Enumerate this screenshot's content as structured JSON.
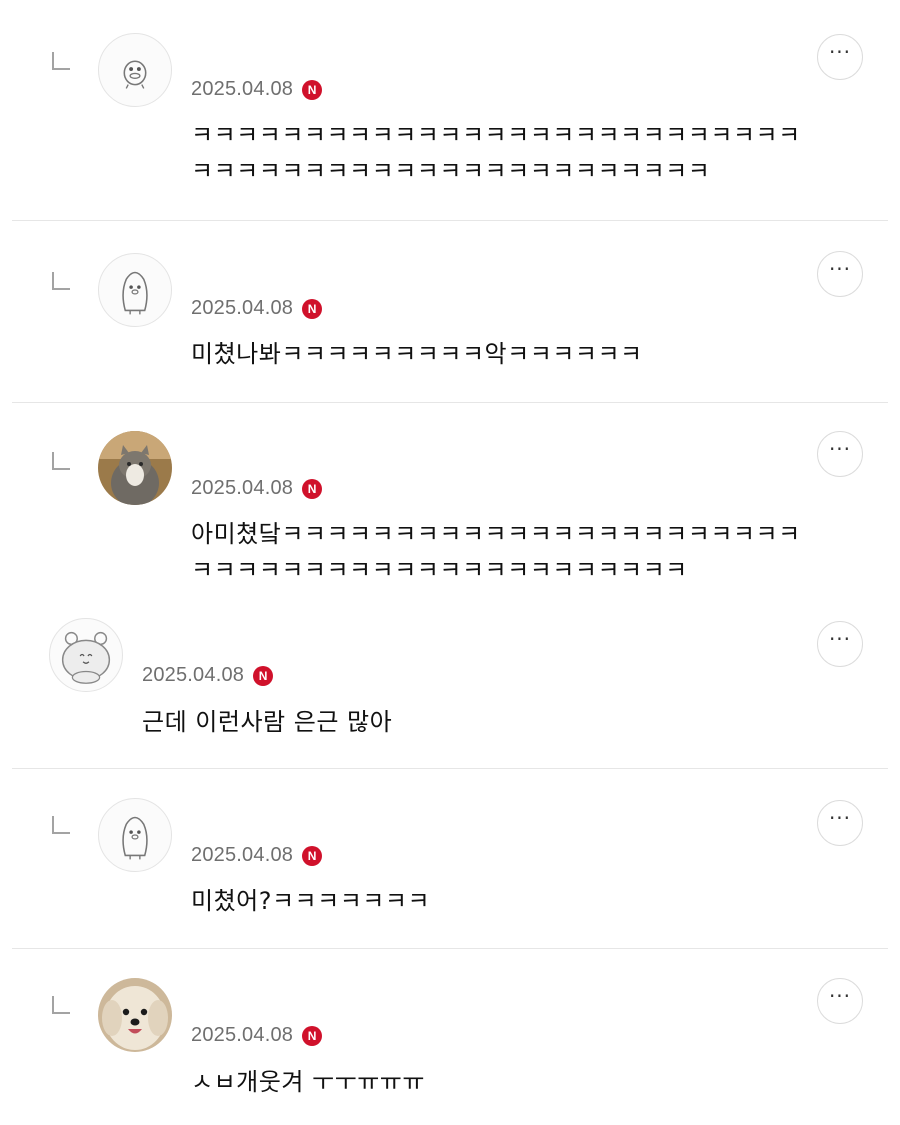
{
  "badge_letter": "N",
  "more_glyph": "···",
  "comments": [
    {
      "date": "2025.04.08",
      "text": "ㅋㅋㅋㅋㅋㅋㅋㅋㅋㅋㅋㅋㅋㅋㅋㅋㅋㅋㅋㅋㅋㅋㅋㅋㅋㅋㅋ\nㅋㅋㅋㅋㅋㅋㅋㅋㅋㅋㅋㅋㅋㅋㅋㅋㅋㅋㅋㅋㅋㅋㅋ",
      "avatar": "duck-character-icon"
    },
    {
      "date": "2025.04.08",
      "text": "미쳤나봐ㅋㅋㅋㅋㅋㅋㅋㅋㅋ악ㅋㅋㅋㅋㅋㅋ",
      "avatar": "penguin-character-icon"
    },
    {
      "date": "2025.04.08",
      "text": "아미쳤닼ㅋㅋㅋㅋㅋㅋㅋㅋㅋㅋㅋㅋㅋㅋㅋㅋㅋㅋㅋㅋㅋㅋㅋ\nㅋㅋㅋㅋㅋㅋㅋㅋㅋㅋㅋㅋㅋㅋㅋㅋㅋㅋㅋㅋㅋㅋ",
      "avatar": "cat-photo-icon"
    },
    {
      "date": "2025.04.08",
      "text": "근데 이런사람 은근 많아",
      "avatar": "hamster-character-icon"
    },
    {
      "date": "2025.04.08",
      "text": "미쳤어?ㅋㅋㅋㅋㅋㅋㅋ",
      "avatar": "penguin-character-icon"
    },
    {
      "date": "2025.04.08",
      "text": "ㅅㅂ개웃겨 ㅜㅜㅠㅠㅠ",
      "avatar": "dog-photo-icon"
    }
  ],
  "colors": {
    "badge": "#d0112b",
    "date": "#6f6f6f",
    "divider": "#e6e6e6"
  }
}
